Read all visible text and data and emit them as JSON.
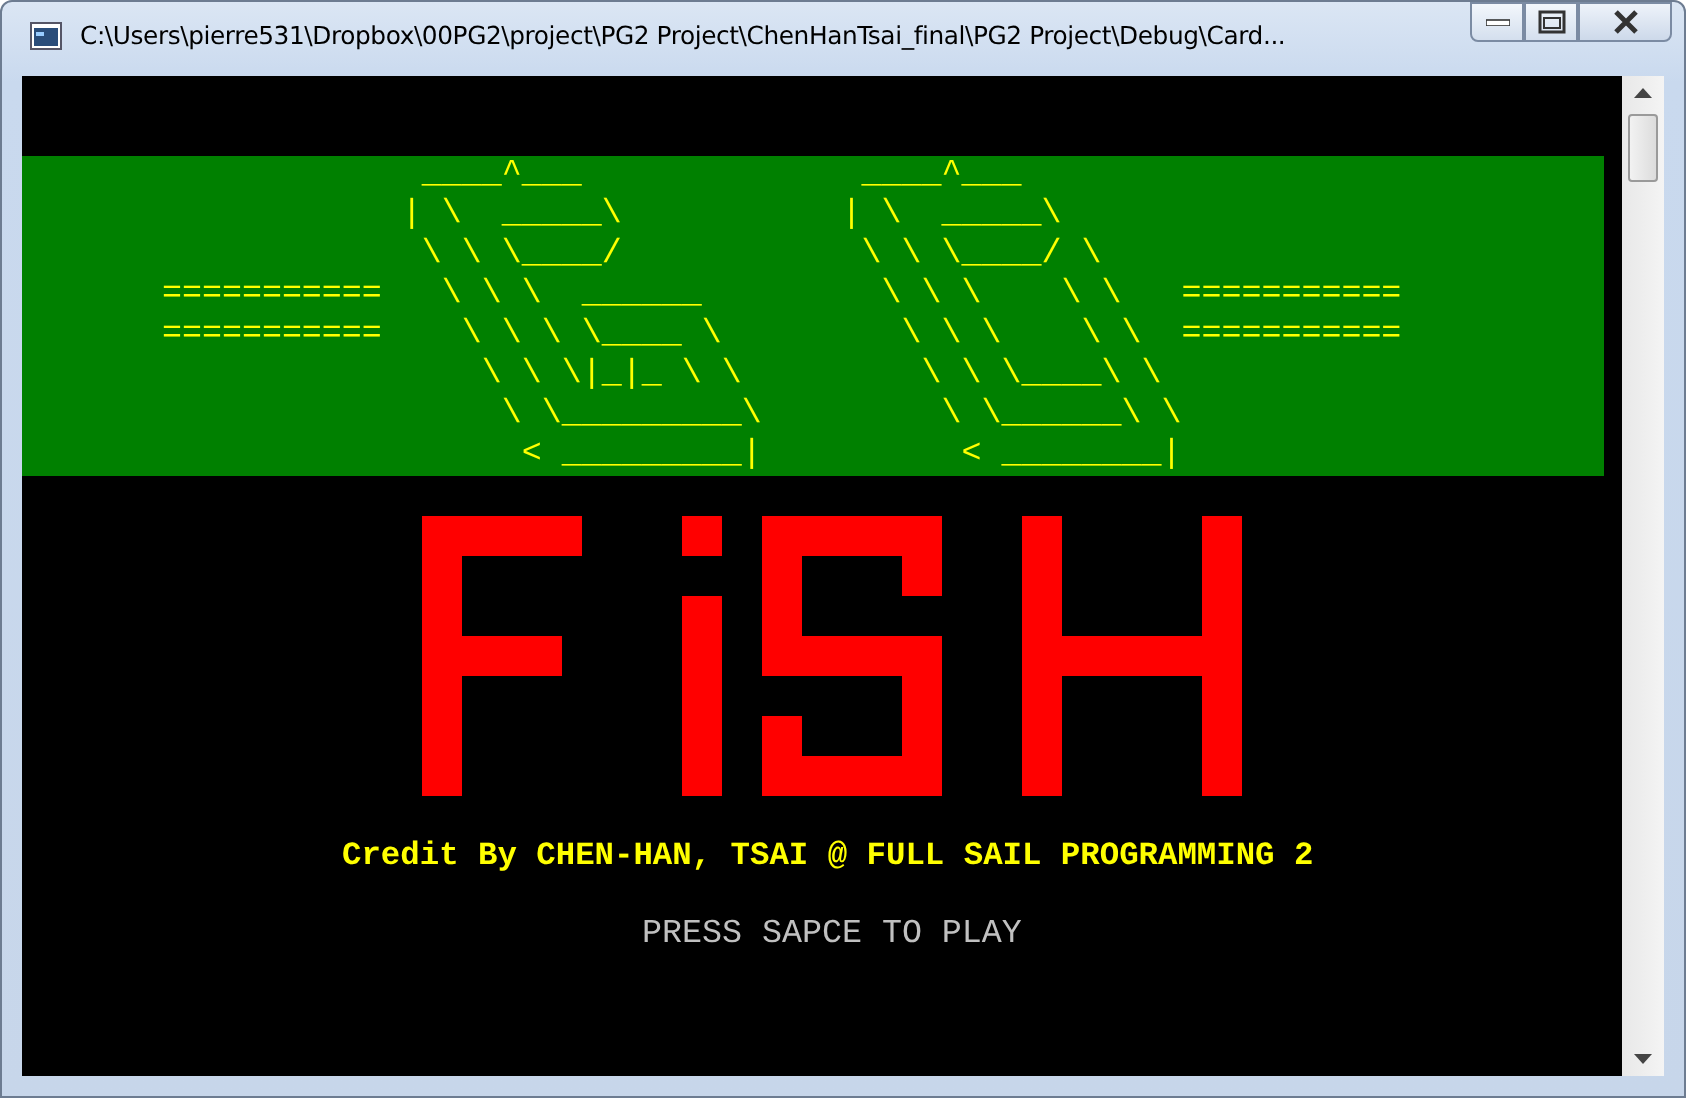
{
  "window": {
    "title": "C:\\Users\\pierre531\\Dropbox\\00PG2\\project\\PG2 Project\\ChenHanTsai_final\\PG2 Project\\Debug\\Card..."
  },
  "console": {
    "banner_lines": [
      "                    ____^___              ____^___",
      "                   | \\  _____\\           | \\  _____\\",
      "                    \\ \\ \\____/            \\ \\ \\____/ \\",
      "       ===========   \\ \\ \\  ______         \\ \\ \\    \\ \\   ===========",
      "       ===========    \\ \\ \\ \\____ \\         \\ \\ \\    \\ \\  ===========",
      "                       \\ \\ \\|_|_ \\ \\         \\ \\ \\____\\ \\",
      "                        \\ \\_________\\         \\ \\______\\ \\",
      "                         < _________|          < ________|"
    ],
    "credit": "Credit By CHEN-HAN, TSAI @ FULL SAIL PROGRAMMING 2",
    "prompt": "PRESS SAPCE TO PLAY"
  }
}
